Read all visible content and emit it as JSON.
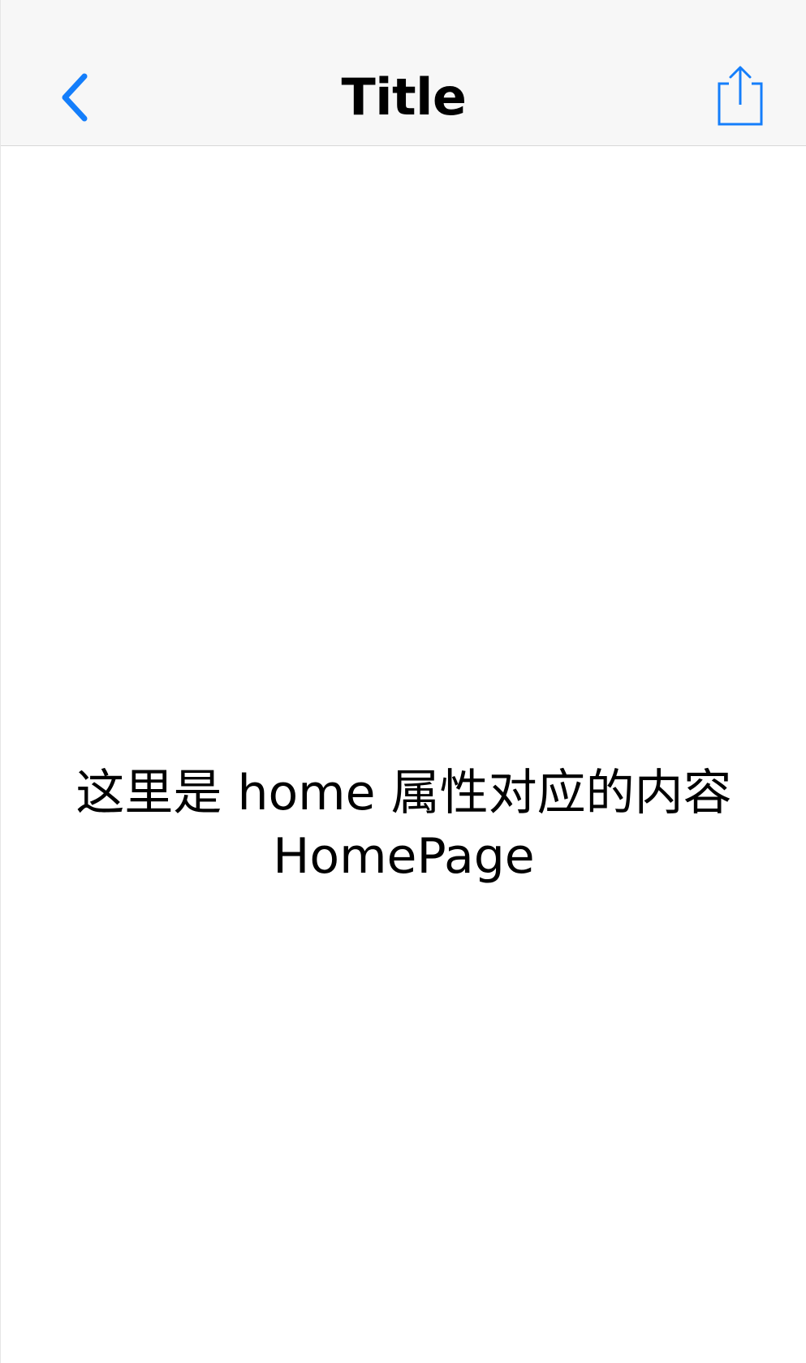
{
  "navbar": {
    "title": "Title",
    "back_icon": "chevron-left-icon",
    "share_icon": "share-icon",
    "accent_color": "#147EFB",
    "background_color": "#F7F7F7"
  },
  "content": {
    "line1": "这里是 home 属性对应的内容",
    "line2": "HomePage",
    "background_color": "#FFFFFF"
  }
}
